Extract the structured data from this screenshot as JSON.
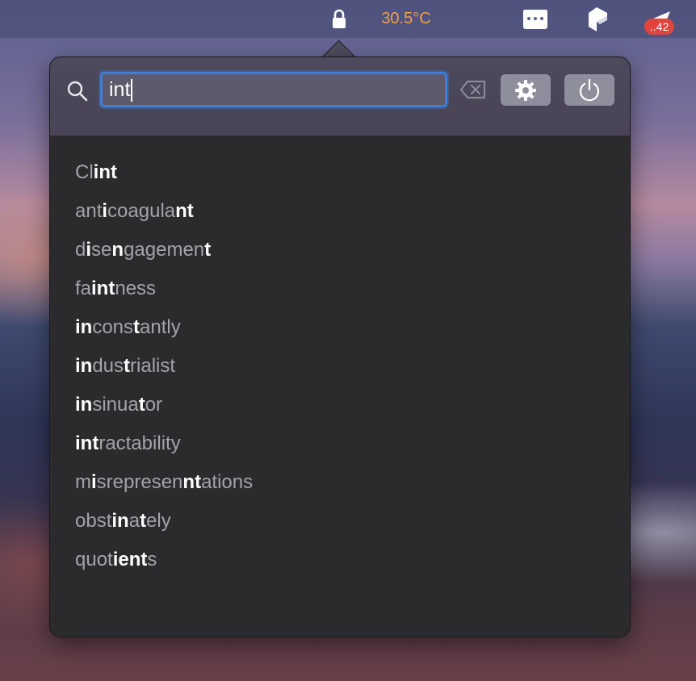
{
  "menubar": {
    "lock_icon": "lock-icon",
    "temperature": "30.5°C",
    "temperature_color": "#f0a04a",
    "icons": [
      "window-dots-icon",
      "cube-icon",
      "paper-plane-icon"
    ],
    "badge": "..42",
    "badge_color": "#e0443c"
  },
  "popover": {
    "search": {
      "value": "int",
      "icon": "search-icon"
    },
    "buttons": {
      "clear": "clear-input-icon",
      "settings": "gear-icon",
      "power": "power-icon"
    },
    "accent": "#3f7ed6",
    "results": [
      {
        "word": "Clint",
        "segments": [
          {
            "t": "Cl",
            "m": false
          },
          {
            "t": "int",
            "m": true
          }
        ]
      },
      {
        "word": "anticoagulant",
        "segments": [
          {
            "t": "ant",
            "m": false
          },
          {
            "t": "i",
            "m": true
          },
          {
            "t": "coagula",
            "m": false
          },
          {
            "t": "nt",
            "m": true
          }
        ]
      },
      {
        "word": "disengagement",
        "segments": [
          {
            "t": "d",
            "m": false
          },
          {
            "t": "i",
            "m": true
          },
          {
            "t": "se",
            "m": false
          },
          {
            "t": "n",
            "m": true
          },
          {
            "t": "gagemen",
            "m": false
          },
          {
            "t": "t",
            "m": true
          }
        ]
      },
      {
        "word": "faintness",
        "segments": [
          {
            "t": "fa",
            "m": false
          },
          {
            "t": "int",
            "m": true
          },
          {
            "t": "ness",
            "m": false
          }
        ]
      },
      {
        "word": "inconstantly",
        "segments": [
          {
            "t": "in",
            "m": true
          },
          {
            "t": "cons",
            "m": false
          },
          {
            "t": "t",
            "m": true
          },
          {
            "t": "antly",
            "m": false
          }
        ]
      },
      {
        "word": "industrialist",
        "segments": [
          {
            "t": "in",
            "m": true
          },
          {
            "t": "dus",
            "m": false
          },
          {
            "t": "t",
            "m": true
          },
          {
            "t": "rialist",
            "m": false
          }
        ]
      },
      {
        "word": "insinuator",
        "segments": [
          {
            "t": "in",
            "m": true
          },
          {
            "t": "sinua",
            "m": false
          },
          {
            "t": "t",
            "m": true
          },
          {
            "t": "or",
            "m": false
          }
        ]
      },
      {
        "word": "intractability",
        "segments": [
          {
            "t": "int",
            "m": true
          },
          {
            "t": "ractability",
            "m": false
          }
        ]
      },
      {
        "word": "misrepresentations",
        "segments": [
          {
            "t": "m",
            "m": false
          },
          {
            "t": "i",
            "m": true
          },
          {
            "t": "srepresen",
            "m": false
          },
          {
            "t": "nt",
            "m": true
          },
          {
            "t": "ations",
            "m": false
          }
        ]
      },
      {
        "word": "obstinately",
        "segments": [
          {
            "t": "obst",
            "m": false
          },
          {
            "t": "in",
            "m": true
          },
          {
            "t": "a",
            "m": false
          },
          {
            "t": "t",
            "m": true
          },
          {
            "t": "ely",
            "m": false
          }
        ]
      },
      {
        "word": "quotients",
        "segments": [
          {
            "t": "quot",
            "m": false
          },
          {
            "t": "ie",
            "m": true
          },
          {
            "t": "nt",
            "m": true
          },
          {
            "t": "s",
            "m": false
          }
        ]
      }
    ]
  }
}
